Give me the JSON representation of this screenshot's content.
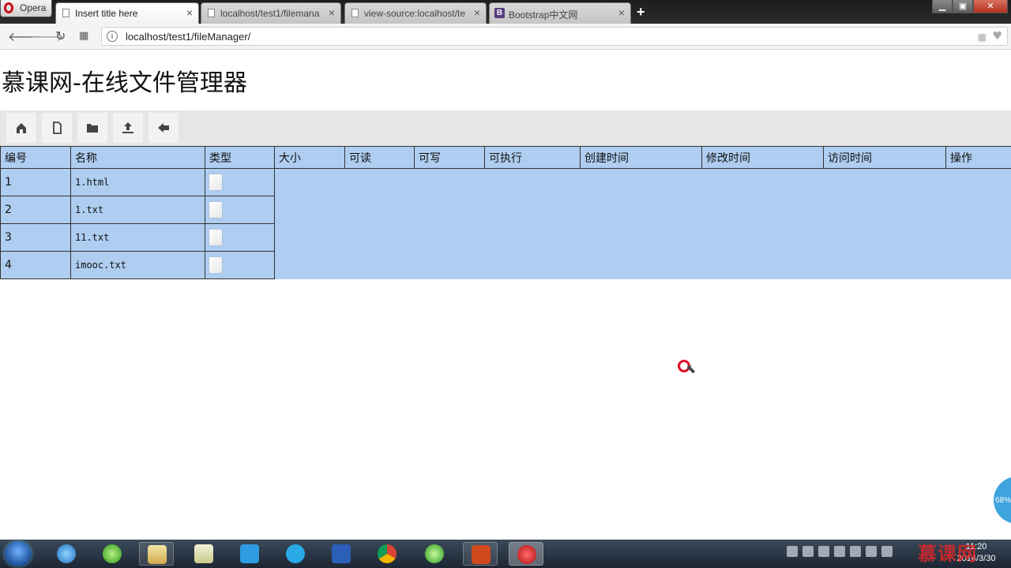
{
  "browser": {
    "menu_label": "Opera",
    "tabs": [
      {
        "label": "Insert title here",
        "active": true
      },
      {
        "label": "localhost/test1/filemana",
        "active": false
      },
      {
        "label": "view-source:localhost/te",
        "active": false
      },
      {
        "label": "Bootstrap中文网",
        "active": false
      }
    ],
    "url": "localhost/test1/fileManager/"
  },
  "page": {
    "title": "慕课网-在线文件管理器",
    "toolbar": [
      "home-icon",
      "new-file-icon",
      "folder-icon",
      "upload-icon",
      "back-icon"
    ],
    "table": {
      "headers": [
        "编号",
        "名称",
        "类型",
        "大小",
        "可读",
        "可写",
        "可执行",
        "创建时间",
        "修改时间",
        "访问时间",
        "操作"
      ],
      "rows": [
        {
          "id": "1",
          "name": "1.html",
          "type_icon": "file-icon"
        },
        {
          "id": "2",
          "name": "1.txt",
          "type_icon": "file-icon"
        },
        {
          "id": "3",
          "name": "11.txt",
          "type_icon": "file-icon"
        },
        {
          "id": "4",
          "name": "imooc.txt",
          "type_icon": "file-icon"
        }
      ]
    }
  },
  "overlay": {
    "zoom_badge": "68%"
  },
  "taskbar": {
    "clock_time": "11:20",
    "clock_date": "2014/3/30",
    "watermark": "慕课网"
  }
}
